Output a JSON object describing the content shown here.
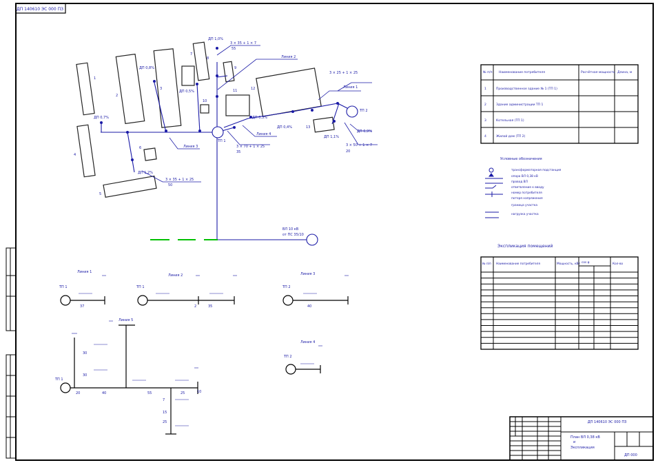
{
  "sheet": {
    "stamp_top": "ДП 140610 ЭС 000 ПЗ",
    "page_number": "ДП 000",
    "frame_color": "#000000",
    "line_color": "#1a1aa6",
    "grid_segment_color": "#00c000"
  },
  "plan": {
    "buildings": [
      {
        "label": "1"
      },
      {
        "label": "2"
      },
      {
        "label": "3"
      },
      {
        "label": "4"
      },
      {
        "label": "5"
      },
      {
        "label": "6"
      },
      {
        "label": "7"
      },
      {
        "label": "8"
      },
      {
        "label": "9"
      },
      {
        "label": "10"
      },
      {
        "label": "11"
      },
      {
        "label": "12"
      },
      {
        "label": "13"
      }
    ],
    "callouts": {
      "top_cable": "3 × 35 + 1 × 7",
      "top_cable_len": "55",
      "line2": "Линия 2",
      "line1": "Линия 1",
      "line3": "Линия 3",
      "line4": "Линия 4",
      "left_cable": "3 × 35 + 1 × 25",
      "left_cable_len": "50",
      "center_cable": "3 × 70 + 1 × 25",
      "center_cable_len": "35",
      "right_cable1": "3 × 25 + 1 × 25",
      "right_cable2": "3 × 50 + 1 × 7",
      "right_cable2_len": "20",
      "tp1": "ТП 1",
      "tp2": "ТП 2",
      "feeder": "ВЛ 10 кВ",
      "feeder_sub": "от ПС 35/10",
      "dp1": "ДП 1,0%",
      "dp2": "ДП 0,8%",
      "dp3": "ДП 0,5%",
      "dp4": "ДП 0,7%",
      "dp5": "ДП 1,2%",
      "dp6": "ДП 0,4%",
      "dp7": "ДП 1,1%",
      "dp8": "ДП 0,3%",
      "dp9": "ДП 0,9%"
    }
  },
  "table1": {
    "headers": [
      "№ п/п",
      "Наименование потребителя",
      "Расчётная мощность",
      "Длина, м"
    ],
    "rows": [
      {
        "n": "1",
        "name": "Производственное здание № 1 (ТП 1)"
      },
      {
        "n": "2",
        "name": "Здание администрации ТП 1"
      },
      {
        "n": "3",
        "name": "Котельная (ТП 1)"
      },
      {
        "n": "4",
        "name": "Жилой дом (ТП 2)"
      }
    ]
  },
  "legend": {
    "title": "Условные обозначения",
    "items": [
      "трансформаторная подстанция",
      "опора ВЛ 0,38 кВ",
      "провод ВЛ",
      "ответвление к вводу",
      "номер потребителя",
      "потеря напряжения",
      "граница участка",
      "нагрузка участка"
    ]
  },
  "table2": {
    "title": "Экспликация помещений",
    "headers": [
      "№ п/п",
      "Наименование потребителя",
      "Мощность, кВт",
      "cos φ",
      "Кол-во"
    ],
    "row_count": 13
  },
  "schemes": {
    "l1": {
      "title": "Линия 1",
      "tp": "ТП 1",
      "len": "37"
    },
    "l2": {
      "title": "Линия 2",
      "tp": "ТП 1",
      "len1": "2",
      "len2": "35"
    },
    "l3": {
      "title": "Линия 3",
      "tp": "ТП 2",
      "len": "40"
    },
    "l4": {
      "title": "Линия 4",
      "tp": "ТП 2"
    },
    "l5": {
      "title": "Линия 5",
      "tp": "ТП 1",
      "len_a": "30",
      "len_b": "30",
      "len_c": "20",
      "len_d": "40",
      "len_e": "55",
      "len_f": "25",
      "len_g": "10",
      "len_h": "25",
      "len_i": "15",
      "len_j": "7"
    }
  },
  "title_block": {
    "code": "ДП 140610 ЭС 000 ПЗ",
    "sheet_title": "План ВЛ 0,38 кВ",
    "sheet_sub": "и",
    "sheet_sub2": "Экспликация"
  }
}
